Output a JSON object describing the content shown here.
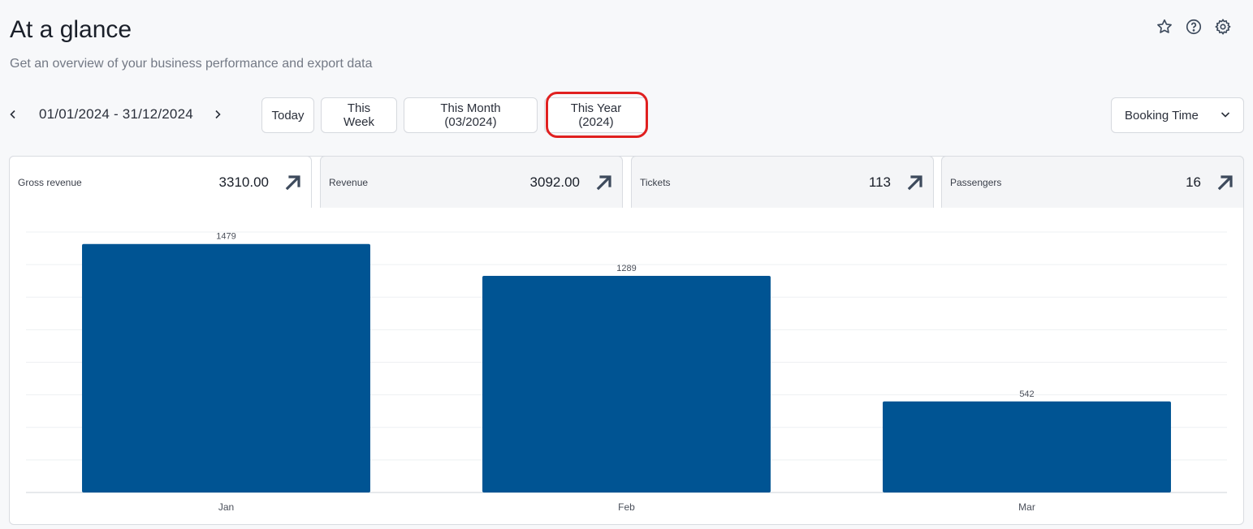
{
  "header": {
    "title": "At a glance",
    "subtitle": "Get an overview of your business performance and export data",
    "icons": [
      "star-icon",
      "help-icon",
      "gear-icon"
    ]
  },
  "date_nav": {
    "range": "01/01/2024 - 31/12/2024",
    "prev_icon": "chevron-left-icon",
    "next_icon": "chevron-right-icon"
  },
  "periods": {
    "today": "Today",
    "this_week": "This Week",
    "this_month": "This Month (03/2024)",
    "this_year": "This Year (2024)"
  },
  "select": {
    "value": "Booking Time",
    "icon": "chevron-down-icon"
  },
  "metrics": [
    {
      "label": "Gross revenue",
      "value": "3310.00",
      "icon": "arrow-up-right-icon"
    },
    {
      "label": "Revenue",
      "value": "3092.00",
      "icon": "arrow-up-right-icon"
    },
    {
      "label": "Tickets",
      "value": "113",
      "icon": "arrow-up-right-icon"
    },
    {
      "label": "Passengers",
      "value": "16",
      "icon": "arrow-up-right-icon"
    }
  ],
  "colors": {
    "bar": "#005493",
    "highlight": "#e02020",
    "icon": "#3d4a5c"
  },
  "chart_data": {
    "type": "bar",
    "categories": [
      "Jan",
      "Feb",
      "Mar"
    ],
    "values": [
      1479,
      1289,
      542
    ],
    "title": "",
    "xlabel": "",
    "ylabel": "",
    "ylim": [
      0,
      1550
    ],
    "grid": true,
    "data_labels": true
  }
}
